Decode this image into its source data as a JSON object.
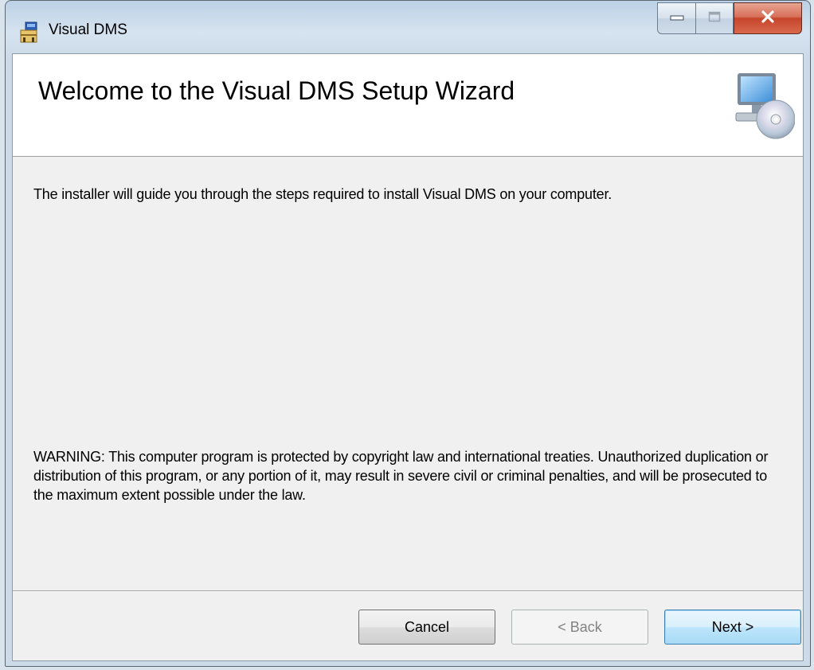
{
  "window": {
    "title": "Visual DMS",
    "icons": {
      "app": "installer-icon",
      "minimize": "minimize-icon",
      "maximize": "maximize-icon",
      "close": "close-icon"
    },
    "colors": {
      "close_button": "#c5452b",
      "client_background": "#f0f0f0",
      "banner_background": "#ffffff"
    }
  },
  "banner": {
    "title": "Welcome to the Visual DMS Setup Wizard",
    "graphic": "computer-cd-icon"
  },
  "body": {
    "intro": "The installer will guide you through the steps required to install Visual DMS on your computer.",
    "warning": "WARNING: This computer program is protected by copyright law and international treaties. Unauthorized duplication or distribution of this program, or any portion of it, may result in severe civil or criminal penalties, and will be prosecuted to the maximum extent possible under the law."
  },
  "buttons": {
    "cancel": "Cancel",
    "back": "< Back",
    "next": "Next >"
  }
}
